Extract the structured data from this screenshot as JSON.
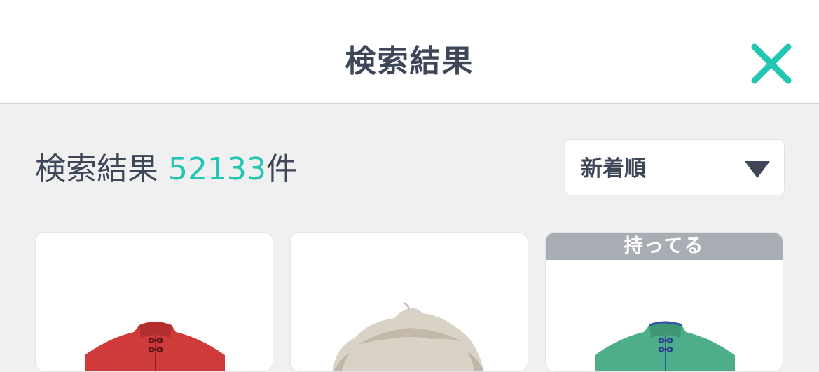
{
  "header": {
    "title": "検索結果",
    "close_icon": "close-icon",
    "close_color": "#23c5b3"
  },
  "results": {
    "label": "検索結果 ",
    "count": "52133",
    "suffix": "件",
    "count_color": "#23c5b3"
  },
  "sort": {
    "selected": "新着順",
    "icon": "triangle-down-icon"
  },
  "items": [
    {
      "name": "red-shirt",
      "owned": false
    },
    {
      "name": "hair",
      "owned": false
    },
    {
      "name": "green-shirt",
      "owned": true,
      "owned_label": "持ってる"
    }
  ]
}
